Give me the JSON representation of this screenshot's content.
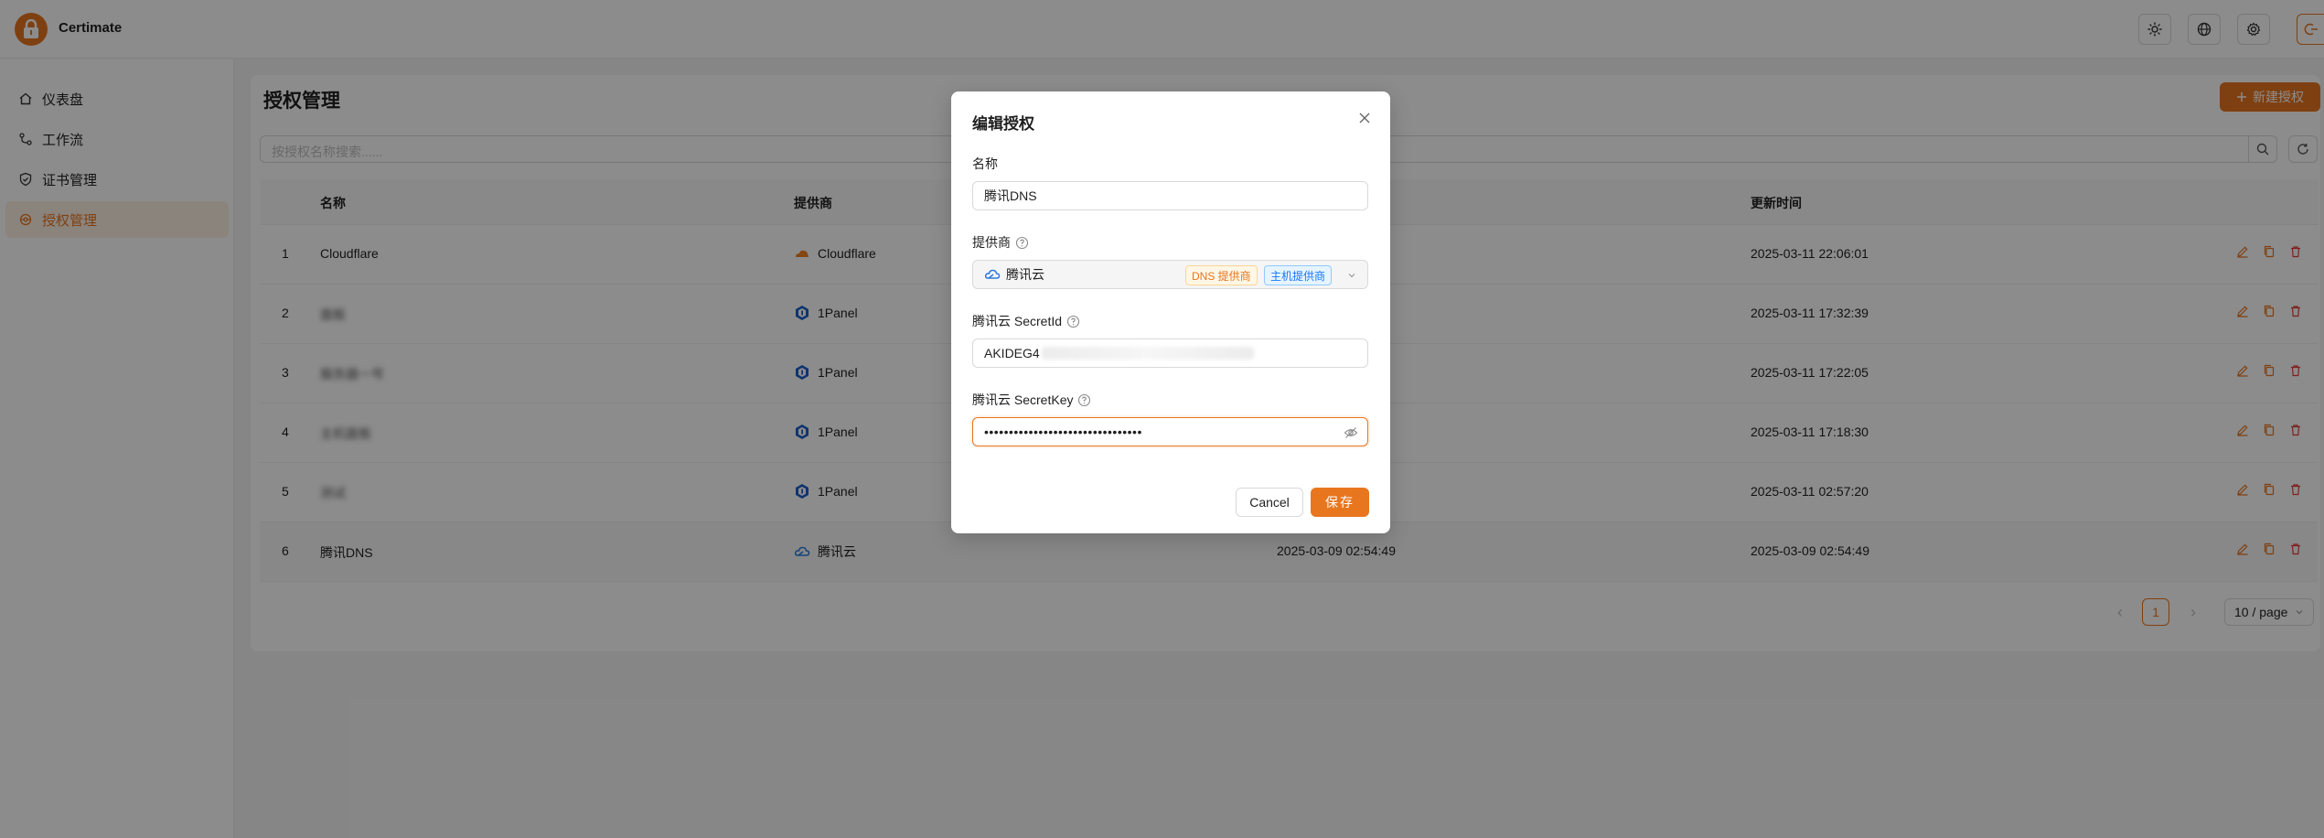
{
  "app": {
    "name": "Certimate",
    "brand_color": "#e8761f"
  },
  "header": {
    "actions": [
      "sun-icon",
      "globe-icon",
      "gear-icon",
      "logout-icon"
    ]
  },
  "sidebar": {
    "items": [
      {
        "label": "仪表盘",
        "icon": "home-icon",
        "active": false
      },
      {
        "label": "工作流",
        "icon": "workflow-icon",
        "active": false
      },
      {
        "label": "证书管理",
        "icon": "shield-check-icon",
        "active": false
      },
      {
        "label": "授权管理",
        "icon": "key-icon",
        "active": true
      }
    ]
  },
  "page": {
    "title": "授权管理",
    "new_button": "新建授权",
    "search_placeholder": "按授权名称搜索......"
  },
  "table": {
    "columns": {
      "name": "名称",
      "provider": "提供商",
      "updated": "更新时间"
    },
    "rows": [
      {
        "index": "1",
        "name": "Cloudflare",
        "name_blurred": false,
        "provider": "Cloudflare",
        "provider_icon": "cloudflare-icon",
        "created": "",
        "updated": "2025-03-11 22:06:01"
      },
      {
        "index": "2",
        "name": "面板",
        "name_blurred": true,
        "provider": "1Panel",
        "provider_icon": "1panel-icon",
        "created": "",
        "updated": "2025-03-11 17:32:39"
      },
      {
        "index": "3",
        "name": "服务器一号",
        "name_blurred": true,
        "provider": "1Panel",
        "provider_icon": "1panel-icon",
        "created": "",
        "updated": "2025-03-11 17:22:05"
      },
      {
        "index": "4",
        "name": "主机面板",
        "name_blurred": true,
        "provider": "1Panel",
        "provider_icon": "1panel-icon",
        "created": "",
        "updated": "2025-03-11 17:18:30"
      },
      {
        "index": "5",
        "name": "测试",
        "name_blurred": true,
        "provider": "1Panel",
        "provider_icon": "1panel-icon",
        "created": "",
        "updated": "2025-03-11 02:57:20"
      },
      {
        "index": "6",
        "name": "腾讯DNS",
        "name_blurred": false,
        "provider": "腾讯云",
        "provider_icon": "tencent-cloud-icon",
        "created": "2025-03-09 02:54:49",
        "updated": "2025-03-09 02:54:49"
      }
    ],
    "row_actions": [
      "edit-icon",
      "copy-icon",
      "delete-icon"
    ]
  },
  "pagination": {
    "current_page": "1",
    "page_size": "10 / page"
  },
  "modal": {
    "title": "编辑授权",
    "name_label": "名称",
    "name_value": "腾讯DNS",
    "provider_label": "提供商",
    "provider_value": "腾讯云",
    "provider_tags": [
      "DNS 提供商",
      "主机提供商"
    ],
    "secret_id_label": "腾讯云 SecretId",
    "secret_id_value": "AKIDEG4",
    "secret_key_label": "腾讯云 SecretKey",
    "secret_key_value": "••••••••••••••••••••••••••••••••",
    "cancel_label": "Cancel",
    "save_label": "保存"
  }
}
